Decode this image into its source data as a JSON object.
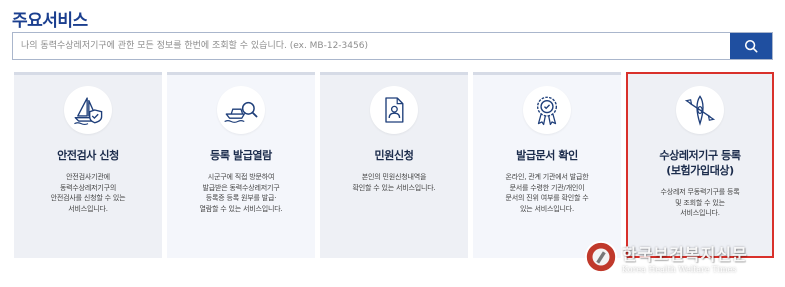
{
  "header": {
    "title": "주요서비스"
  },
  "search": {
    "placeholder": "나의 동력수상레저기구에 관한 모든 정보를 한번에 조회할 수 있습니다. (ex. MB-12-3456)",
    "button_icon": "search-icon"
  },
  "cards": [
    {
      "title_line1": "안전검사 신청",
      "title_line2": "",
      "desc": [
        "안전검사기관에",
        "동력수상레저기구의",
        "안전검사를 신청할 수 있는",
        "서비스입니다."
      ],
      "icon": "sailboat-shield-icon"
    },
    {
      "title_line1": "등록 발급열람",
      "title_line2": "",
      "desc": [
        "시군구에 직접 방문하여",
        "발급받은 동력수상레저기구",
        "등록증 등록 원부를 발급·",
        "열람할 수 있는 서비스입니다."
      ],
      "icon": "boat-search-icon"
    },
    {
      "title_line1": "민원신청",
      "title_line2": "",
      "desc": [
        "본인의 민원신청내역을",
        "확인할 수 있는 서비스입니다."
      ],
      "icon": "document-person-icon"
    },
    {
      "title_line1": "발급문서 확인",
      "title_line2": "",
      "desc": [
        "온라인, 관계 기관에서 발급한",
        "문서를 수령한 기관/개인이",
        "문서의 진위 여부를 확인할 수",
        "있는 서비스입니다."
      ],
      "icon": "certificate-badge-icon"
    },
    {
      "title_line1": "수상레저기구 등록",
      "title_line2": "(보험가입대상)",
      "desc": [
        "수상레저 무동력기구를 등록",
        "및 조회할 수 있는",
        "서비스입니다."
      ],
      "icon": "kayak-paddle-icon"
    }
  ],
  "watermark": {
    "kr": "한국보건복지신문",
    "en": "Korea Health Welfare Times"
  },
  "colors": {
    "accent": "#1f4fa0",
    "title": "#1b3f8f",
    "highlight_border": "#d9312b",
    "card_bg": "#eef0f5"
  }
}
